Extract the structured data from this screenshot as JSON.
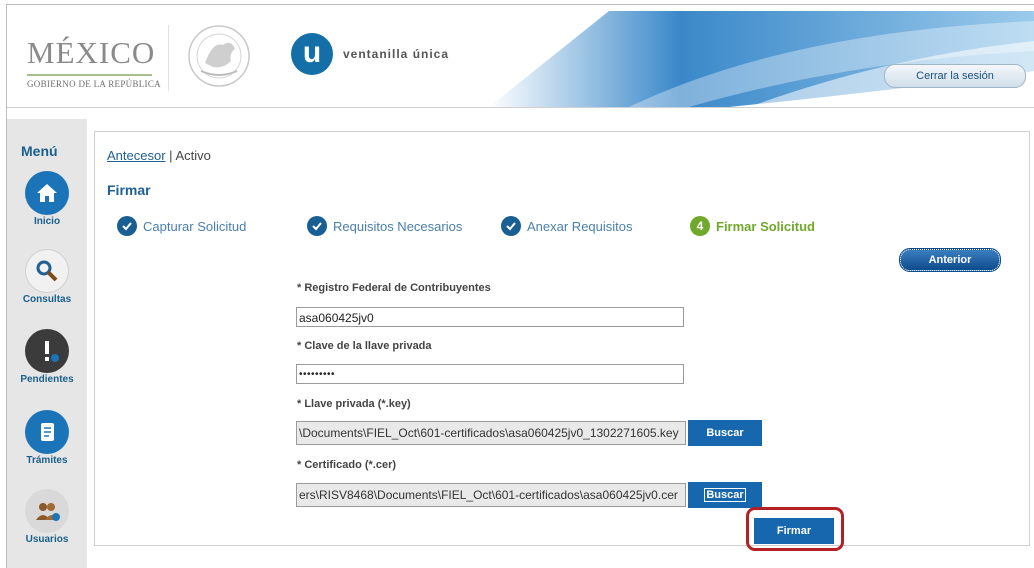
{
  "header": {
    "brand_title": "MÉXICO",
    "brand_subtitle": "GOBIERNO DE LA REPÚBLICA",
    "logo_letter": "u",
    "portal_name": "ventanilla única",
    "logout_label": "Cerrar la sesión"
  },
  "sidebar": {
    "title": "Menú",
    "items": [
      {
        "label": "Inicio",
        "icon": "home-icon"
      },
      {
        "label": "Consultas",
        "icon": "magnifier-icon"
      },
      {
        "label": "Pendientes",
        "icon": "alert-icon"
      },
      {
        "label": "Trámites",
        "icon": "document-icon"
      },
      {
        "label": "Usuarios",
        "icon": "users-icon"
      }
    ]
  },
  "breadcrumb": {
    "link": "Antecesor",
    "separator": "|",
    "current": "Activo"
  },
  "page": {
    "title": "Firmar"
  },
  "steps": [
    {
      "label": "Capturar Solicitud",
      "state": "done"
    },
    {
      "label": "Requisitos Necesarios",
      "state": "done"
    },
    {
      "label": "Anexar Requisitos",
      "state": "done"
    },
    {
      "label": "Firmar Solicitud",
      "state": "current",
      "number": "4"
    }
  ],
  "buttons": {
    "previous": "Anterior",
    "browse_key": "Buscar",
    "browse_cert": "Buscar",
    "sign": "Firmar"
  },
  "form": {
    "rfc_label": "* Registro Federal de Contribuyentes",
    "rfc_value": "asa060425jv0",
    "password_label": "* Clave de la llave privada",
    "password_value": "•••••••••",
    "key_label": "* Llave privada (*.key)",
    "key_value": "\\Documents\\FIEL_Oct\\601-certificados\\asa060425jv0_1302271605.key",
    "cert_label": "* Certificado (*.cer)",
    "cert_value": "ers\\RISV8468\\Documents\\FIEL_Oct\\601-certificados\\asa060425jv0.cer"
  },
  "colors": {
    "primary": "#1667ad",
    "header_text": "#1f5f94",
    "current_step": "#6fa92b",
    "highlight": "#b32026",
    "sidebar_bg": "#e6e6e6"
  }
}
